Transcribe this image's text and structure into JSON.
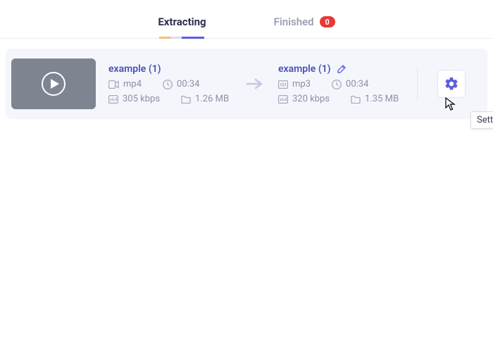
{
  "tabs": {
    "extracting": "Extracting",
    "finished": "Finished",
    "finished_count": "0"
  },
  "item": {
    "source": {
      "name": "example (1)",
      "format": "mp4",
      "duration": "00:34",
      "bitrate": "305 kbps",
      "size": "1.26 MB"
    },
    "target": {
      "name": "example (1)",
      "format": "mp3",
      "duration": "00:34",
      "bitrate": "320 kbps",
      "size": "1.35 MB"
    }
  },
  "tooltip": "Settings"
}
